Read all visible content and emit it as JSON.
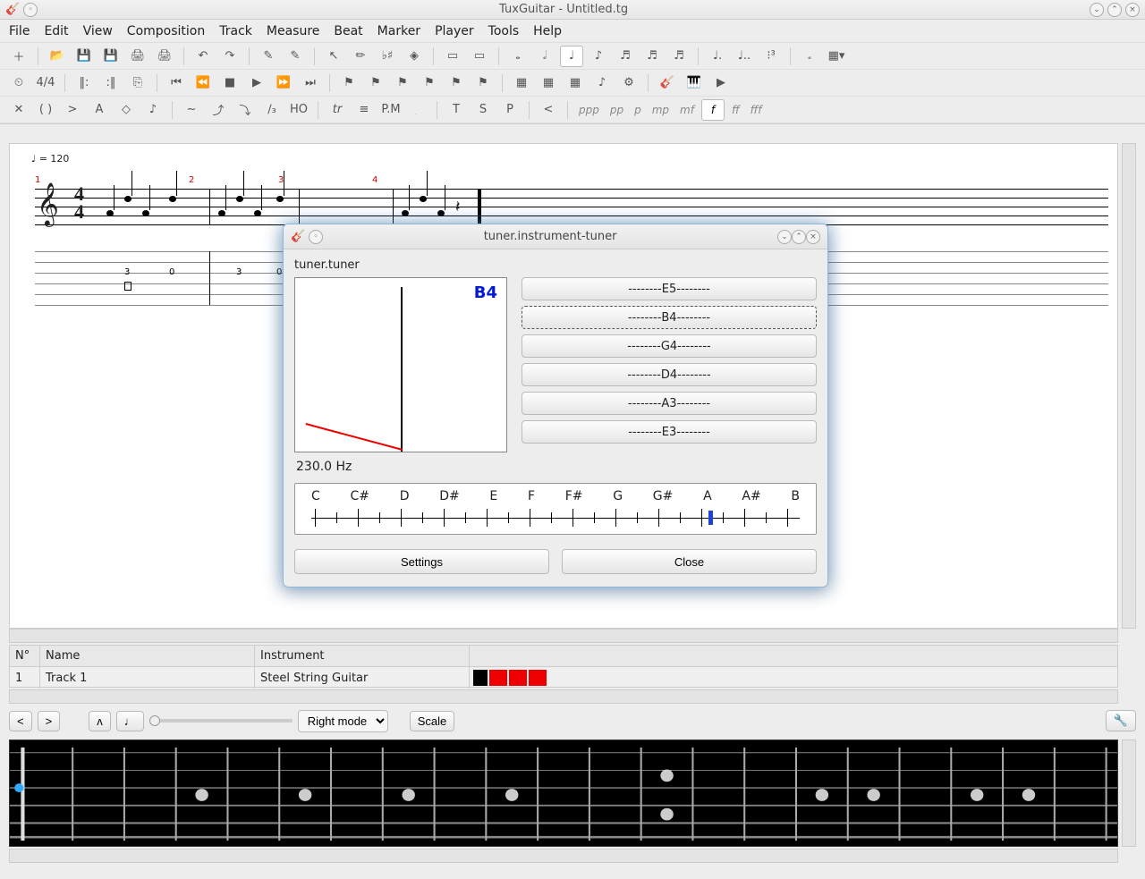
{
  "window": {
    "title": "TuxGuitar - Untitled.tg"
  },
  "menu": [
    "File",
    "Edit",
    "View",
    "Composition",
    "Track",
    "Measure",
    "Beat",
    "Marker",
    "Player",
    "Tools",
    "Help"
  ],
  "dynamics": [
    "ppp",
    "pp",
    "p",
    "mp",
    "mf",
    "f",
    "ff",
    "fff"
  ],
  "tempo": "= 120",
  "timesig": {
    "top": "4",
    "bot": "4"
  },
  "measure_nums": [
    "1",
    "2",
    "3",
    "4"
  ],
  "tab_frets": [
    "3",
    "0",
    "3",
    "0"
  ],
  "tracktable": {
    "headers": {
      "n": "N°",
      "name": "Name",
      "instr": "Instrument"
    },
    "row": {
      "n": "1",
      "name": "Track 1",
      "instr": "Steel String Guitar"
    }
  },
  "bottom": {
    "mode": "Right mode",
    "scale": "Scale"
  },
  "tuner": {
    "title": "tuner.instrument-tuner",
    "label": "tuner.tuner",
    "current_note": "B4",
    "frequency": "230.0 Hz",
    "strings": [
      "E5",
      "B4",
      "G4",
      "D4",
      "A3",
      "E3"
    ],
    "selected_string": 1,
    "scale_notes": [
      "C",
      "C#",
      "D",
      "D#",
      "E",
      "F",
      "F#",
      "G",
      "G#",
      "A",
      "A#",
      "B"
    ],
    "buttons": {
      "settings": "Settings",
      "close": "Close"
    }
  }
}
